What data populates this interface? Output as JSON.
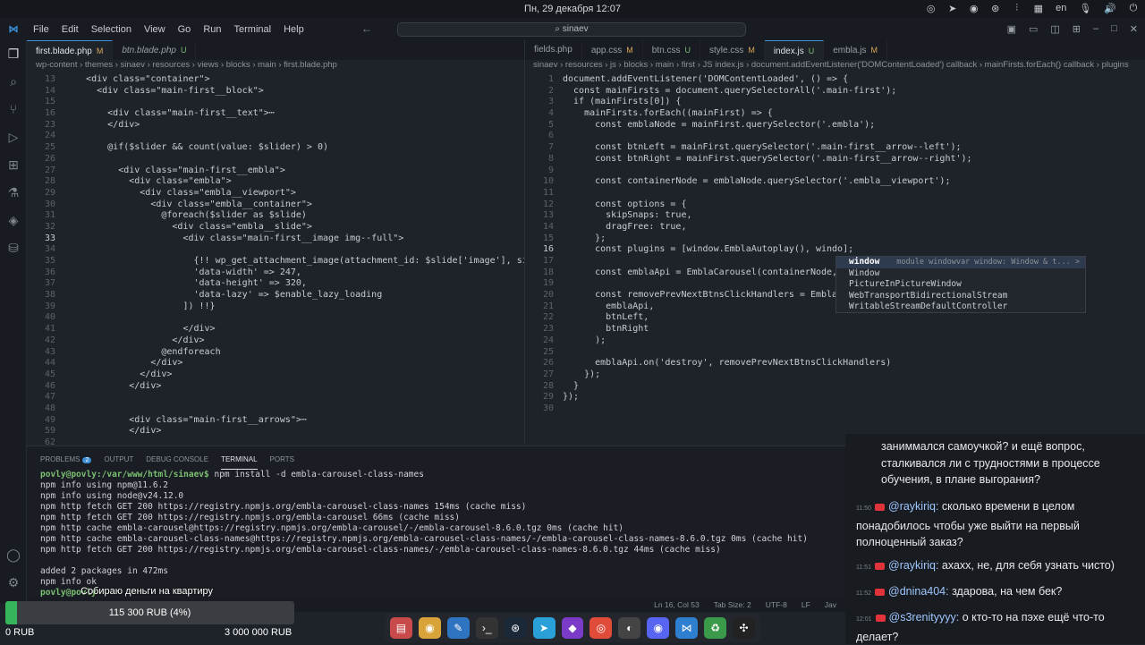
{
  "topbar": {
    "clock": "Пн, 29 декабря 12:07",
    "lang": "en",
    "tray_icons": [
      "chrome-icon",
      "telegram-icon",
      "discord-icon",
      "steam-icon",
      "equalizer-icon",
      "app-icon",
      "lang",
      "mic-icon",
      "volume-icon",
      "power-icon"
    ]
  },
  "menubar": {
    "items": [
      "File",
      "Edit",
      "Selection",
      "View",
      "Go",
      "Run",
      "Terminal",
      "Help"
    ],
    "search": "sinaev"
  },
  "left_editor": {
    "tabs": [
      {
        "label": "first.blade.php",
        "status": "M",
        "active": true
      },
      {
        "label": "btn.blade.php",
        "status": "U",
        "active": false
      }
    ],
    "breadcrumb": "wp-content  ›  themes  ›  sinaev  ›  resources  ›  views  ›  blocks  ›  main  ›  first.blade.php",
    "lines": [
      {
        "n": "13",
        "c": "    <div class=\"container\">"
      },
      {
        "n": "14",
        "c": "      <div class=\"main-first__block\">"
      },
      {
        "n": "15",
        "c": ""
      },
      {
        "n": "16",
        "c": "        <div class=\"main-first__text\">⋯"
      },
      {
        "n": "23",
        "c": "        </div>"
      },
      {
        "n": "24",
        "c": ""
      },
      {
        "n": "25",
        "c": "        @if($slider && count(value: $slider) > 0)"
      },
      {
        "n": "26",
        "c": ""
      },
      {
        "n": "27",
        "c": "          <div class=\"main-first__embla\">"
      },
      {
        "n": "28",
        "c": "            <div class=\"embla\">"
      },
      {
        "n": "29",
        "c": "              <div class=\"embla__viewport\">"
      },
      {
        "n": "30",
        "c": "                <div class=\"embla__container\">"
      },
      {
        "n": "31",
        "c": "                  @foreach($slider as $slide)"
      },
      {
        "n": "32",
        "c": "                    <div class=\"embla__slide\">"
      },
      {
        "n": "33",
        "c": "                      <div class=\"main-first__image img--full\">"
      },
      {
        "n": "34",
        "c": ""
      },
      {
        "n": "35",
        "c": "                        {!! wp_get_attachment_image(attachment_id: $slide['image'], size: 'fu"
      },
      {
        "n": "36",
        "c": "                        'data-width' => 247,"
      },
      {
        "n": "37",
        "c": "                        'data-height' => 320,"
      },
      {
        "n": "38",
        "c": "                        'data-lazy' => $enable_lazy_loading"
      },
      {
        "n": "39",
        "c": "                      ]) !!}"
      },
      {
        "n": "40",
        "c": ""
      },
      {
        "n": "41",
        "c": "                      </div>"
      },
      {
        "n": "42",
        "c": "                    </div>"
      },
      {
        "n": "43",
        "c": "                  @endforeach"
      },
      {
        "n": "44",
        "c": "                </div>"
      },
      {
        "n": "45",
        "c": "              </div>"
      },
      {
        "n": "46",
        "c": "            </div>"
      },
      {
        "n": "47",
        "c": ""
      },
      {
        "n": "48",
        "c": ""
      },
      {
        "n": "49",
        "c": "            <div class=\"main-first__arrows\">⋯"
      },
      {
        "n": "59",
        "c": "            </div>"
      },
      {
        "n": "62",
        "c": ""
      }
    ]
  },
  "right_editor": {
    "tabs": [
      {
        "label": "fields.php",
        "status": "",
        "active": false
      },
      {
        "label": "app.css",
        "status": "M",
        "active": false
      },
      {
        "label": "btn.css",
        "status": "U",
        "active": false
      },
      {
        "label": "style.css",
        "status": "M",
        "active": false
      },
      {
        "label": "index.js",
        "status": "U",
        "active": true
      },
      {
        "label": "embla.js",
        "status": "M",
        "active": false
      }
    ],
    "breadcrumb": "sinaev › resources › js › blocks › main › first › JS index.js › document.addEventListener('DOMContentLoaded') callback › mainFirsts.forEach() callback › plugins",
    "lines": [
      {
        "n": "1",
        "c": "document.addEventListener('DOMContentLoaded', () => {"
      },
      {
        "n": "2",
        "c": "  const mainFirsts = document.querySelectorAll('.main-first');"
      },
      {
        "n": "3",
        "c": "  if (mainFirsts[0]) {"
      },
      {
        "n": "4",
        "c": "    mainFirsts.forEach((mainFirst) => {"
      },
      {
        "n": "5",
        "c": "      const emblaNode = mainFirst.querySelector('.embla');"
      },
      {
        "n": "6",
        "c": ""
      },
      {
        "n": "7",
        "c": "      const btnLeft = mainFirst.querySelector('.main-first__arrow--left');"
      },
      {
        "n": "8",
        "c": "      const btnRight = mainFirst.querySelector('.main-first__arrow--right');"
      },
      {
        "n": "9",
        "c": ""
      },
      {
        "n": "10",
        "c": "      const containerNode = emblaNode.querySelector('.embla__viewport');"
      },
      {
        "n": "11",
        "c": ""
      },
      {
        "n": "12",
        "c": "      const options = {"
      },
      {
        "n": "13",
        "c": "        skipSnaps: true,"
      },
      {
        "n": "14",
        "c": "        dragFree: true,"
      },
      {
        "n": "15",
        "c": "      };"
      },
      {
        "n": "16",
        "c": "      const plugins = [window.EmblaAutoplay(), windo];"
      },
      {
        "n": "17",
        "c": ""
      },
      {
        "n": "18",
        "c": "      const emblaApi = EmblaCarousel(containerNode,"
      },
      {
        "n": "19",
        "c": ""
      },
      {
        "n": "20",
        "c": "      const removePrevNextBtnsClickHandlers = EmblaA"
      },
      {
        "n": "21",
        "c": "        emblaApi,"
      },
      {
        "n": "22",
        "c": "        btnLeft,"
      },
      {
        "n": "23",
        "c": "        btnRight"
      },
      {
        "n": "24",
        "c": "      );"
      },
      {
        "n": "25",
        "c": ""
      },
      {
        "n": "26",
        "c": "      emblaApi.on('destroy', removePrevNextBtnsClickHandlers)"
      },
      {
        "n": "27",
        "c": "    });"
      },
      {
        "n": "28",
        "c": "  }"
      },
      {
        "n": "29",
        "c": "});"
      },
      {
        "n": "30",
        "c": ""
      }
    ]
  },
  "suggest": {
    "detail": "module windowvar window: Window & t... >",
    "items": [
      "window",
      "Window",
      "PictureInPictureWindow",
      "WebTransportBidirectionalStream",
      "WritableStreamDefaultController"
    ]
  },
  "panel": {
    "tabs": [
      "PROBLEMS",
      "OUTPUT",
      "DEBUG CONSOLE",
      "TERMINAL",
      "PORTS"
    ],
    "problems_count": "2",
    "prompt": "povly@povly:/var/www/html/sinaev$",
    "command": " npm install -d embla-carousel-class-names",
    "lines": [
      "npm info using npm@11.6.2",
      "npm info using node@v24.12.0",
      "npm http fetch GET 200 https://registry.npmjs.org/embla-carousel-class-names 154ms (cache miss)",
      "npm http fetch GET 200 https://registry.npmjs.org/embla-carousel 66ms (cache miss)",
      "npm http cache embla-carousel@https://registry.npmjs.org/embla-carousel/-/embla-carousel-8.6.0.tgz 0ms (cache hit)",
      "npm http cache embla-carousel-class-names@https://registry.npmjs.org/embla-carousel-class-names/-/embla-carousel-class-names-8.6.0.tgz 0ms (cache hit)",
      "npm http fetch GET 200 https://registry.npmjs.org/embla-carousel-class-names/-/embla-carousel-class-names-8.6.0.tgz 44ms (cache miss)",
      "",
      "added 2 packages in 472ms",
      "npm info ok"
    ],
    "last_prompt": "povly@povly"
  },
  "statusbar": {
    "position": "Ln 16, Col 53",
    "tab": "Tab Size: 2",
    "encoding": "UTF-8",
    "eol": "LF",
    "lang": "Jav"
  },
  "goal": {
    "title": "Собираю деньги на квартиру",
    "text": "115 300 RUB (4%)",
    "progress": 0.04,
    "min": "0 RUB",
    "max": "3 000 000 RUB"
  },
  "chat": {
    "messages": [
      {
        "time": "",
        "user": "",
        "text": "заниммался самоучкой? и ещё вопрос, сталкивался ли с трудностями в процессе обучения, в плане выгорания?"
      },
      {
        "time": "11:50",
        "user": "@raykiriq:",
        "text": "сколько времени в целом понадобилось чтобы уже выйти на первый полноценный заказ?"
      },
      {
        "time": "11:51",
        "user": "@raykiriq:",
        "text": "ахахх, не, для себя узнать чисто)"
      },
      {
        "time": "11:52",
        "user": "@dnina404:",
        "text": "здарова, на чем бек?"
      },
      {
        "time": "12:01",
        "user": "@s3renityyyy:",
        "text": "о кто-то на пэхе ещё что-то делает?"
      }
    ]
  },
  "colors": {
    "accent": "#3d8fd8",
    "goal_fill": "#37b55a",
    "youtube": "#e0333a"
  }
}
